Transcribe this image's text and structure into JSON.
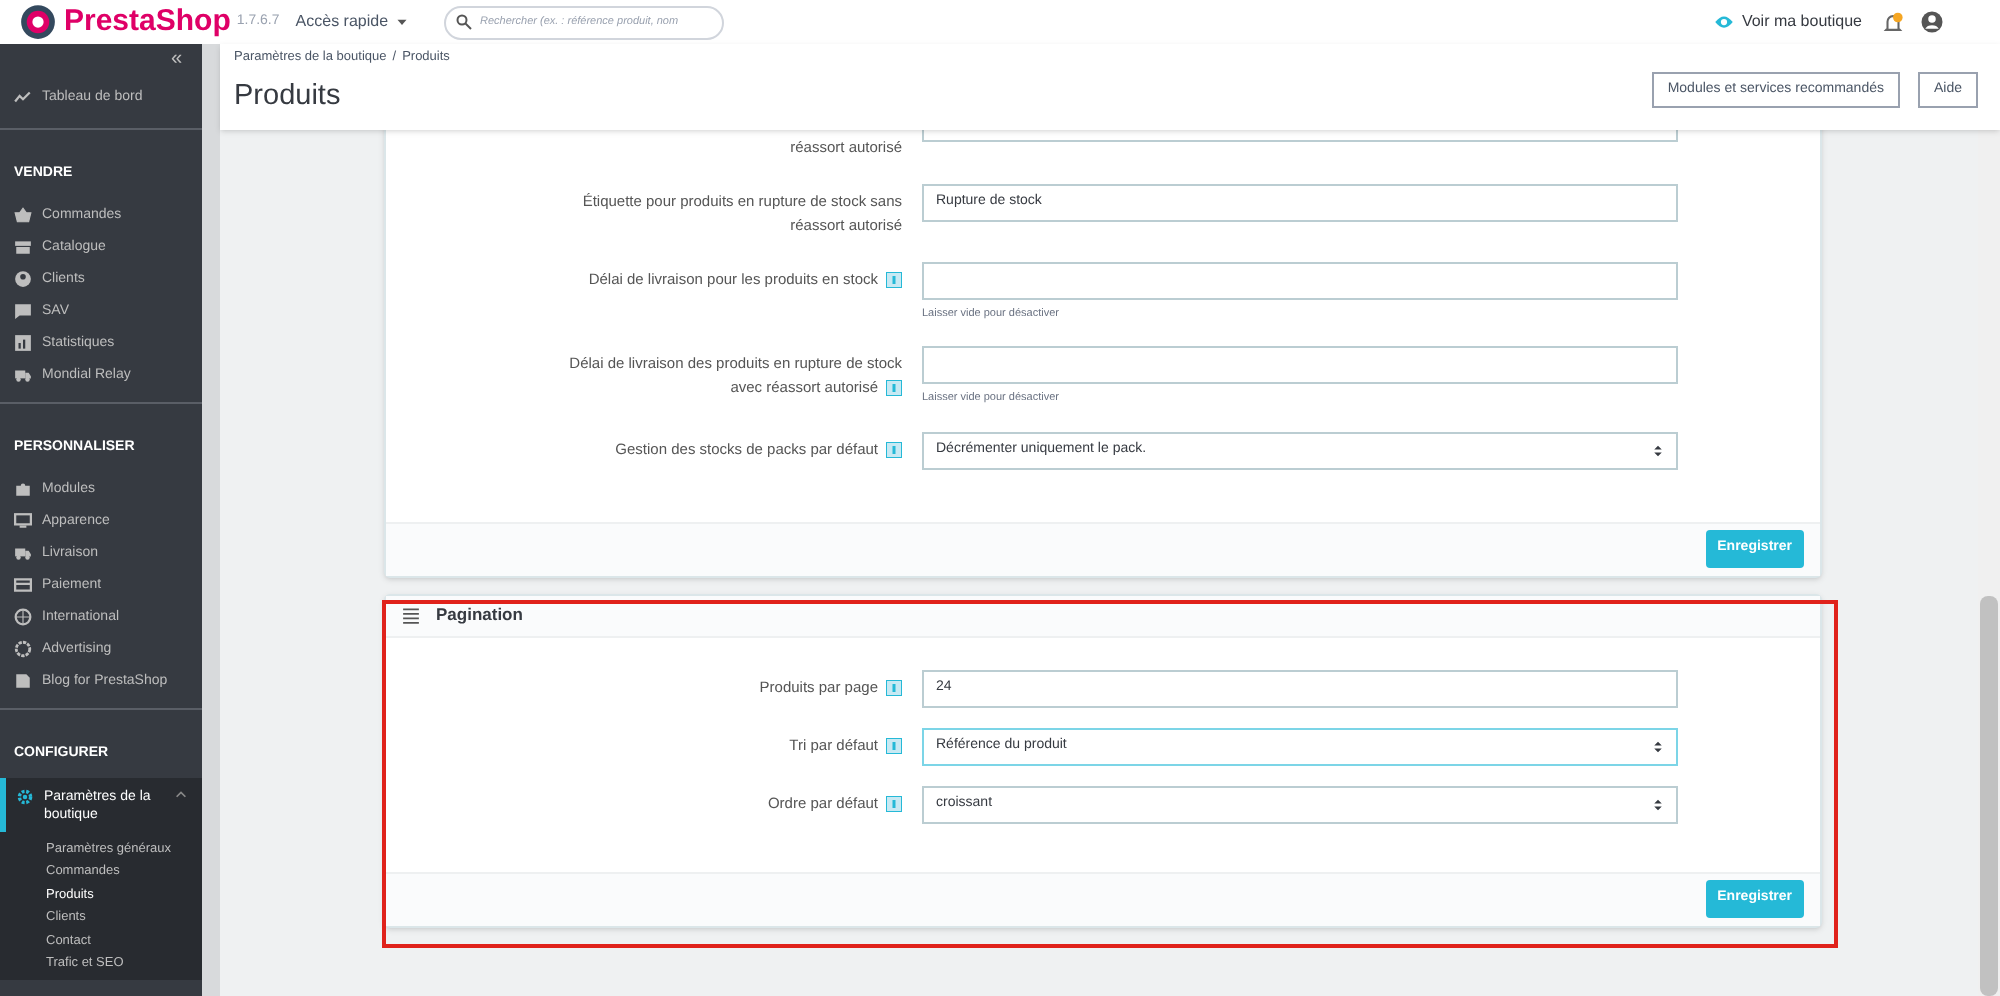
{
  "topbar": {
    "logo": "PrestaShop",
    "version": "1.7.6.7",
    "quick_access": "Accès rapide",
    "search": {
      "placeholder": "Rechercher (ex. : référence produit, nom"
    },
    "view_shop": "Voir ma boutique",
    "notifications_badge": true
  },
  "header": {
    "breadcrumb": {
      "items": [
        "Paramètres de la boutique",
        "Produits"
      ],
      "separator": "/"
    },
    "title": "Produits",
    "buttons": [
      "Modules et services recommandés",
      "Aide"
    ]
  },
  "sidebar": {
    "collapse": "«",
    "items": [
      {
        "kind": "link",
        "label": "Tableau de bord",
        "selected": false
      },
      {
        "kind": "section",
        "label": "VENDRE"
      },
      {
        "kind": "link",
        "label": "Commandes",
        "selected": false
      },
      {
        "kind": "link",
        "label": "Catalogue",
        "selected": false
      },
      {
        "kind": "link",
        "label": "Clients",
        "selected": false
      },
      {
        "kind": "link",
        "label": "SAV",
        "selected": false
      },
      {
        "kind": "link",
        "label": "Statistiques",
        "selected": false
      },
      {
        "kind": "link",
        "label": "Mondial Relay",
        "selected": false
      },
      {
        "kind": "section",
        "label": "PERSONNALISER"
      },
      {
        "kind": "link",
        "label": "Modules",
        "selected": false
      },
      {
        "kind": "link",
        "label": "Apparence",
        "selected": false
      },
      {
        "kind": "link",
        "label": "Livraison",
        "selected": false
      },
      {
        "kind": "link",
        "label": "Paiement",
        "selected": false
      },
      {
        "kind": "link",
        "label": "International",
        "selected": false
      },
      {
        "kind": "link",
        "label": "Advertising",
        "selected": false
      },
      {
        "kind": "link",
        "label": "Blog for PrestaShop",
        "selected": false
      },
      {
        "kind": "section",
        "label": "CONFIGURER"
      },
      {
        "kind": "link",
        "label": "Paramètres de la boutique",
        "selected": true,
        "expanded": true,
        "children": [
          {
            "label": "Paramètres généraux",
            "selected": false
          },
          {
            "label": "Commandes",
            "selected": false
          },
          {
            "label": "Produits",
            "selected": true
          },
          {
            "label": "Clients",
            "selected": false
          },
          {
            "label": "Contact",
            "selected": false
          },
          {
            "label": "Trafic et SEO",
            "selected": false
          }
        ]
      }
    ]
  },
  "panels": [
    {
      "highlighted": false,
      "rows": [
        {
          "kind": "input",
          "label": "réassort autorisé",
          "help": false,
          "clipped": true
        },
        {
          "kind": "input",
          "label": "Étiquette pour produits en rupture de stock sans réassort autorisé",
          "help": false,
          "value": "Rupture de stock"
        },
        {
          "kind": "input",
          "label": "Délai de livraison pour les produits en stock",
          "help": true,
          "hint": "Laisser vide pour désactiver"
        },
        {
          "kind": "input",
          "label": "Délai de livraison des produits en rupture de stock avec réassort autorisé",
          "help": true,
          "hint": "Laisser vide pour désactiver"
        },
        {
          "kind": "select",
          "label": "Gestion des stocks de packs par défaut",
          "help": true,
          "value": "Décrémenter uniquement le pack."
        }
      ],
      "save": "Enregistrer"
    },
    {
      "title": "Pagination",
      "highlighted": true,
      "rows": [
        {
          "kind": "input",
          "label": "Produits par page",
          "help": true,
          "value": "24"
        },
        {
          "kind": "select",
          "label": "Tri par défaut",
          "help": true,
          "value": "Référence du produit",
          "focused": true
        },
        {
          "kind": "select",
          "label": "Ordre par défaut",
          "help": true,
          "value": "croissant"
        }
      ],
      "save": "Enregistrer"
    }
  ]
}
